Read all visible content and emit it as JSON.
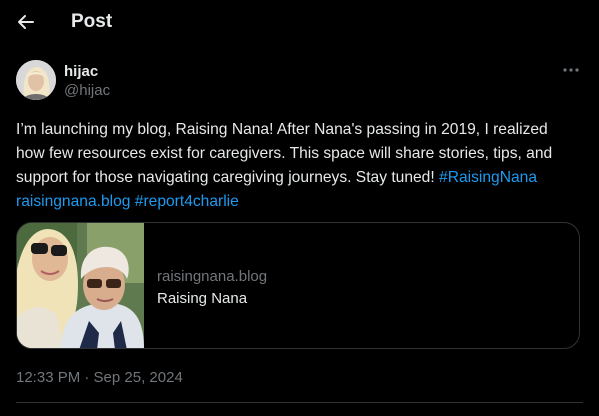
{
  "header": {
    "back_icon": "arrow-left-icon",
    "title": "Post"
  },
  "author": {
    "display_name": "hijac",
    "handle": "@hijac",
    "avatar_icon": "user-avatar"
  },
  "more_icon": "more-horizontal-icon",
  "post": {
    "text_plain": "I’m launching my blog, Raising Nana! After Nana's passing in 2019, I realized how few resources exist for caregivers. This space will share stories, tips, and support for those navigating caregiving journeys. Stay tuned! ",
    "hashtag_1": "#RaisingNana",
    "link": "raisingnana.blog",
    "hashtag_2": "#report4charlie",
    "link_color": "#1d9bf0"
  },
  "card": {
    "domain": "raisingnana.blog",
    "title": "Raising Nana",
    "image_description": "two-women-selfie-photo"
  },
  "timestamp": "12:33 PM · Sep 25, 2024",
  "colors": {
    "background": "#000000",
    "text_primary": "#e7e9ea",
    "text_secondary": "#71767b",
    "border": "#2f3336"
  }
}
